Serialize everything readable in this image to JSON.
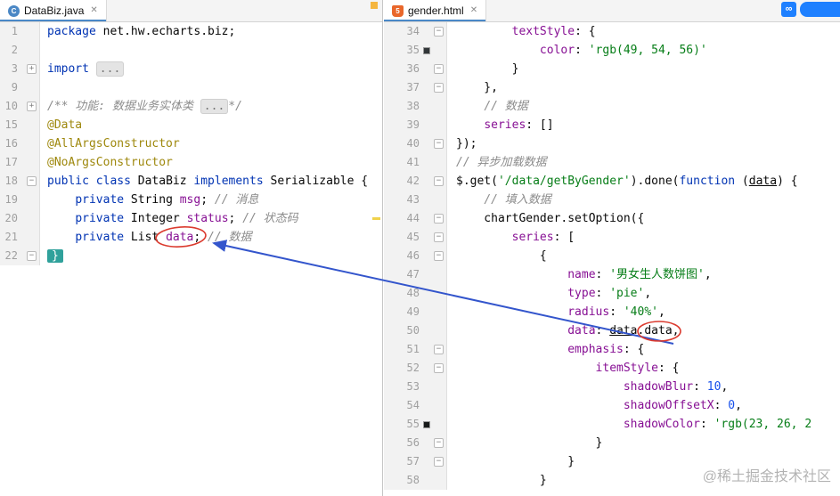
{
  "window": {
    "watermark": "@稀土掘金技术社区",
    "badge": {
      "logo": "∞",
      "label": ""
    },
    "colors": {
      "accent_blue": "#1e80ff",
      "arrow_blue": "#3355cc",
      "circle_red": "#db3b2f",
      "keyword": "#0033b3",
      "string": "#067d17",
      "comment": "#8c8c8c",
      "annotation_olive": "#9e880d",
      "member_purple": "#871094",
      "number_blue": "#1750eb",
      "brace_teal": "#2fa19b",
      "warning_yellow": "#f5b63f",
      "ok_green": "#59a869"
    }
  },
  "left_pane": {
    "tab": {
      "title": "DataBiz.java",
      "icon_glyph": "C"
    },
    "close_glyph": "✕",
    "lines": [
      {
        "n": "1",
        "t": [
          [
            "kw",
            "package"
          ],
          [
            "p",
            " net.hw.echarts.biz;"
          ]
        ]
      },
      {
        "n": "2",
        "t": []
      },
      {
        "n": "3",
        "t": [
          [
            "kw",
            "import"
          ],
          [
            "p",
            " "
          ],
          [
            "fold",
            "..."
          ]
        ],
        "fold": "plus"
      },
      {
        "n": "9",
        "t": []
      },
      {
        "n": "10",
        "t": [
          [
            "com",
            "/** 功能: 数据业务实体类 "
          ],
          [
            "fold",
            "..."
          ],
          [
            "com",
            "*/"
          ]
        ],
        "fold": "plus"
      },
      {
        "n": "15",
        "t": [
          [
            "ann",
            "@Data"
          ]
        ]
      },
      {
        "n": "16",
        "t": [
          [
            "ann",
            "@AllArgsConstructor"
          ]
        ]
      },
      {
        "n": "17",
        "t": [
          [
            "ann",
            "@NoArgsConstructor"
          ]
        ]
      },
      {
        "n": "18",
        "t": [
          [
            "kw",
            "public"
          ],
          [
            "p",
            " "
          ],
          [
            "kw",
            "class"
          ],
          [
            "p",
            " DataBiz "
          ],
          [
            "kw",
            "implements"
          ],
          [
            "p",
            " Serializable {"
          ]
        ],
        "fold": "minus"
      },
      {
        "n": "19",
        "t": [
          [
            "p",
            "    "
          ],
          [
            "kw",
            "private"
          ],
          [
            "p",
            " String "
          ],
          [
            "fld",
            "msg"
          ],
          [
            "p",
            "; "
          ],
          [
            "com",
            "// 消息"
          ]
        ]
      },
      {
        "n": "20",
        "t": [
          [
            "p",
            "    "
          ],
          [
            "kw",
            "private"
          ],
          [
            "p",
            " Integer "
          ],
          [
            "fld",
            "status"
          ],
          [
            "p",
            "; "
          ],
          [
            "com",
            "// 状态码"
          ]
        ]
      },
      {
        "n": "21",
        "t": [
          [
            "p",
            "    "
          ],
          [
            "kw",
            "private"
          ],
          [
            "p",
            " List "
          ],
          [
            "fld",
            "data"
          ],
          [
            "p",
            "; "
          ],
          [
            "com",
            "// 数据"
          ]
        ]
      },
      {
        "n": "22",
        "t": [
          [
            "hl",
            "}"
          ]
        ],
        "fold": "end"
      }
    ]
  },
  "right_pane": {
    "tab": {
      "title": "gender.html",
      "icon_glyph": "5"
    },
    "close_glyph": "✕",
    "inspection_ok_glyph": "✔",
    "lines": [
      {
        "n": "34",
        "t": [
          [
            "p",
            "        "
          ],
          [
            "prop",
            "textStyle"
          ],
          [
            "p",
            ": {"
          ]
        ],
        "fold": "minus"
      },
      {
        "n": "35",
        "t": [
          [
            "p",
            "            "
          ],
          [
            "prop",
            "color"
          ],
          [
            "p",
            ": "
          ],
          [
            "str",
            "'rgb(49, 54, 56)'"
          ]
        ],
        "swatch": "#313638"
      },
      {
        "n": "36",
        "t": [
          [
            "p",
            "        }"
          ]
        ],
        "fold": "end"
      },
      {
        "n": "37",
        "t": [
          [
            "p",
            "    },"
          ]
        ],
        "fold": "end"
      },
      {
        "n": "38",
        "t": [
          [
            "p",
            "    "
          ],
          [
            "com",
            "// 数据"
          ]
        ]
      },
      {
        "n": "39",
        "t": [
          [
            "p",
            "    "
          ],
          [
            "prop",
            "series"
          ],
          [
            "p",
            ": []"
          ]
        ]
      },
      {
        "n": "40",
        "t": [
          [
            "p",
            "});"
          ]
        ],
        "fold": "end"
      },
      {
        "n": "41",
        "t": [
          [
            "com",
            "// 异步加载数据"
          ]
        ]
      },
      {
        "n": "42",
        "t": [
          [
            "p",
            "$.get("
          ],
          [
            "str",
            "'/data/getByGender'"
          ],
          [
            "p",
            ").done("
          ],
          [
            "kw",
            "function"
          ],
          [
            "p",
            " ("
          ],
          [
            "u",
            "data"
          ],
          [
            "p",
            ") {"
          ]
        ],
        "fold": "minus"
      },
      {
        "n": "43",
        "t": [
          [
            "p",
            "    "
          ],
          [
            "com",
            "// 填入数据"
          ]
        ]
      },
      {
        "n": "44",
        "t": [
          [
            "p",
            "    chartGender.setOption({"
          ]
        ],
        "fold": "minus"
      },
      {
        "n": "45",
        "t": [
          [
            "p",
            "        "
          ],
          [
            "prop",
            "series"
          ],
          [
            "p",
            ": ["
          ]
        ],
        "fold": "minus"
      },
      {
        "n": "46",
        "t": [
          [
            "p",
            "            {"
          ]
        ],
        "fold": "minus"
      },
      {
        "n": "47",
        "t": [
          [
            "p",
            "                "
          ],
          [
            "prop",
            "name"
          ],
          [
            "p",
            ": "
          ],
          [
            "str",
            "'男女生人数饼图'"
          ],
          [
            "p",
            ","
          ]
        ]
      },
      {
        "n": "48",
        "t": [
          [
            "p",
            "                "
          ],
          [
            "prop",
            "type"
          ],
          [
            "p",
            ": "
          ],
          [
            "str",
            "'pie'"
          ],
          [
            "p",
            ","
          ]
        ]
      },
      {
        "n": "49",
        "t": [
          [
            "p",
            "                "
          ],
          [
            "prop",
            "radius"
          ],
          [
            "p",
            ": "
          ],
          [
            "str",
            "'40%'"
          ],
          [
            "p",
            ","
          ]
        ]
      },
      {
        "n": "50",
        "t": [
          [
            "p",
            "                "
          ],
          [
            "prop",
            "data"
          ],
          [
            "p",
            ": "
          ],
          [
            "u",
            "data"
          ],
          [
            "p",
            ".data,"
          ]
        ]
      },
      {
        "n": "51",
        "t": [
          [
            "p",
            "                "
          ],
          [
            "prop",
            "emphasis"
          ],
          [
            "p",
            ": {"
          ]
        ],
        "fold": "minus"
      },
      {
        "n": "52",
        "t": [
          [
            "p",
            "                    "
          ],
          [
            "prop",
            "itemStyle"
          ],
          [
            "p",
            ": {"
          ]
        ],
        "fold": "minus"
      },
      {
        "n": "53",
        "t": [
          [
            "p",
            "                        "
          ],
          [
            "prop",
            "shadowBlur"
          ],
          [
            "p",
            ": "
          ],
          [
            "num",
            "10"
          ],
          [
            "p",
            ","
          ]
        ]
      },
      {
        "n": "54",
        "t": [
          [
            "p",
            "                        "
          ],
          [
            "prop",
            "shadowOffsetX"
          ],
          [
            "p",
            ": "
          ],
          [
            "num",
            "0"
          ],
          [
            "p",
            ","
          ]
        ]
      },
      {
        "n": "55",
        "t": [
          [
            "p",
            "                        "
          ],
          [
            "prop",
            "shadowColor"
          ],
          [
            "p",
            ": "
          ],
          [
            "str",
            "'rgb(23, 26, 2"
          ]
        ],
        "swatch": "#171a19"
      },
      {
        "n": "56",
        "t": [
          [
            "p",
            "                    }"
          ]
        ],
        "fold": "end"
      },
      {
        "n": "57",
        "t": [
          [
            "p",
            "                }"
          ]
        ],
        "fold": "end"
      },
      {
        "n": "58",
        "t": [
          [
            "p",
            "            }"
          ]
        ]
      }
    ]
  }
}
